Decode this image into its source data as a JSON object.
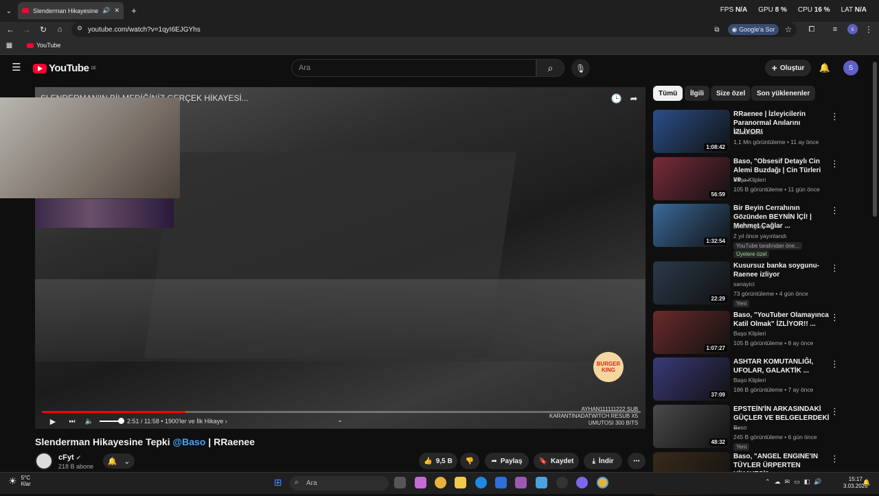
{
  "browser": {
    "tab_title": "Slenderman Hikayesine Tepki",
    "url": "youtube.com/watch?v=1qyI6EJGYhs",
    "google_btn": "Google'a Sor",
    "bookmark": "YouTube",
    "perf": {
      "fps_label": "FPS",
      "fps": "N/A",
      "gpu_label": "GPU",
      "gpu": "8 %",
      "cpu_label": "CPU",
      "cpu": "16 %",
      "lat_label": "LAT",
      "lat": "N/A"
    }
  },
  "yt": {
    "logo": "YouTube",
    "region": "DE",
    "search_placeholder": "Ara",
    "create_label": "Oluştur",
    "avatar_letter": "S"
  },
  "video": {
    "overlay_title": "SLENDERMAN'IN BİLMEDİĞİNİZ GERÇEK HİKAYESİ...",
    "time": "2:51 / 11:58",
    "chapter": "• 1900'ler ve İlk Hikaye ›",
    "progress": 0.24,
    "stream_overlay": [
      "AYHAN111111222 SUB",
      "KARANTINADATWITCH RESUB X5",
      "UMUTOSI 300 BITS"
    ],
    "ad_logo": "BURGER KING"
  },
  "meta": {
    "title_pre": "Slenderman Hikayesine Tepki ",
    "title_mention": "@Baso",
    "title_post": " | RRaenee",
    "channel": "cFyt",
    "subs": "218 B abone",
    "likes": "9,5 B",
    "share": "Paylaş",
    "save": "Kaydet",
    "download": "İndir"
  },
  "chips": [
    "Tümü",
    "İlgili",
    "Size özel",
    "Son yüklenenler"
  ],
  "recs": [
    {
      "title": "RRaenee | İzleyicilerin Paranormal Anılarını İZLİYOR!",
      "channel": "TibetRaenn",
      "meta": "1,1 Mn görüntüleme • 11 ay önce",
      "dur": "1:08:42",
      "color": "#2a4f8a",
      "extra": ""
    },
    {
      "title": "Baso, \"Obsesif Detaylı Cin Alemi Buzdağı | Cin Türleri ve ...",
      "channel": "Başo Klipleri",
      "meta": "105 B görüntüleme • 11 gün önce",
      "dur": "56:59",
      "color": "#7a2a3a",
      "extra": ""
    },
    {
      "title": "Bir Beyin Cerrahının Gözünden BEYNİN İÇİ! | Mehmet Çağlar ...",
      "channel": "Evrim Ağacı",
      "meta": "2 yıl önce yayınlandı",
      "dur": "1:32:54",
      "color": "#3a6a9a",
      "extra": "YouTube tarafından öne...",
      "badge": "Üyelere özel"
    },
    {
      "title": "Kusursuz banka soygunu- Raenee izliyor",
      "channel": "sanayici",
      "meta": "73 görüntüleme • 4 gün önce",
      "dur": "22:29",
      "color": "#2a3a4a",
      "extra": "Yeni"
    },
    {
      "title": "Baso, \"YouTuber Olamayınca Katil Olmak\" İZLİYOR!! ...",
      "channel": "Başo Klipleri",
      "meta": "105 B görüntüleme • 8 ay önce",
      "dur": "1:07:27",
      "color": "#6a2a2a",
      "extra": ""
    },
    {
      "title": "ASHTAR KOMUTANLIĞI, UFOLAR, GALAKTİK ...",
      "channel": "Başo Klipleri",
      "meta": "186 B görüntüleme • 7 ay önce",
      "dur": "37:09",
      "color": "#3a3a7a",
      "extra": ""
    },
    {
      "title": "EPSTEİN'İN ARKASINDAKİ GÜÇLER VE BELGELERDEKİ ...",
      "channel": "Baso",
      "meta": "245 B görüntüleme • 6 gün önce",
      "dur": "48:32",
      "color": "#4a4a4a",
      "extra": "Yeni"
    },
    {
      "title": "Baso, \"ANGEL ENGINE'IN TÜYLER ÜRPERTEN HİKAYESİ\"...",
      "channel": "",
      "meta": "",
      "dur": "",
      "color": "#3a2a1a",
      "extra": ""
    }
  ],
  "taskbar": {
    "temp": "5°C",
    "weather": "Klar",
    "search": "Ara",
    "time": "15:17",
    "date": "3.03.2026"
  }
}
